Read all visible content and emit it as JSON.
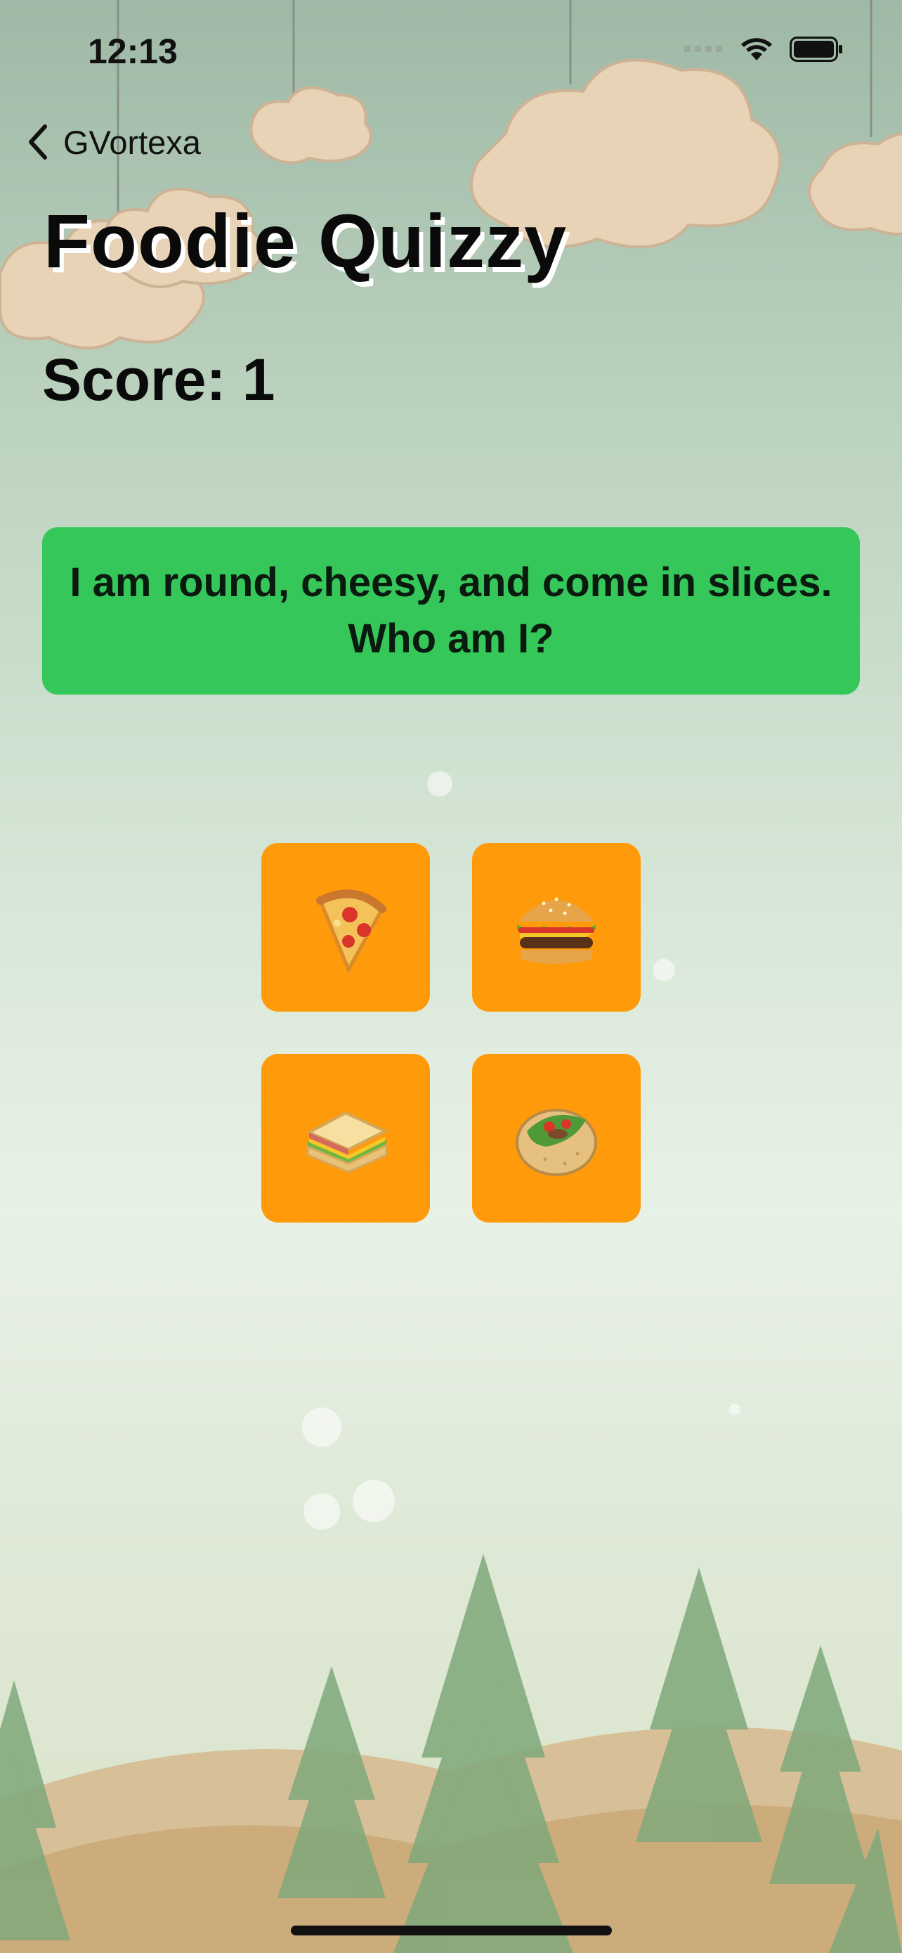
{
  "status_bar": {
    "time": "12:13"
  },
  "nav": {
    "back_label": "GVortexa"
  },
  "title": "Foodie Quizzy",
  "score_text": "Score: 1",
  "question": {
    "text": "I am round, cheesy, and come in slices. Who am I?"
  },
  "answers": [
    {
      "icon": "pizza-icon"
    },
    {
      "icon": "burger-icon"
    },
    {
      "icon": "sandwich-icon"
    },
    {
      "icon": "burrito-icon"
    }
  ],
  "colors": {
    "question_bg": "#35c75a",
    "answer_bg": "#ff9a0a",
    "text": "#0a0a0a"
  }
}
